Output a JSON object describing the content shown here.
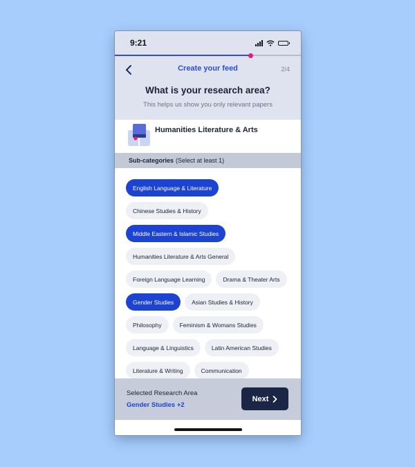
{
  "status_bar": {
    "time": "9:21"
  },
  "progress": {
    "fraction": 0.73
  },
  "nav": {
    "title": "Create your feed",
    "step": "2/4"
  },
  "question": {
    "title": "What is your research area?",
    "subtitle": "This helps us show you only relevant papers"
  },
  "research_area": {
    "name": "Humanities Literature & Arts"
  },
  "subcategories": {
    "heading": "Sub-categories",
    "hint": "(Select at least 1)",
    "chips": [
      {
        "label": "English Language & Literature",
        "selected": true
      },
      {
        "label": "Chinese Studies & History",
        "selected": false
      },
      {
        "label": "Middle Eastern & Islamic Studies",
        "selected": true
      },
      {
        "label": "Humanities Literature & Arts General",
        "selected": false
      },
      {
        "label": "Foreign Language Learning",
        "selected": false
      },
      {
        "label": "Drama & Theater Arts",
        "selected": false
      },
      {
        "label": "Gender Studies",
        "selected": true
      },
      {
        "label": "Asian Studies & History",
        "selected": false
      },
      {
        "label": "Philosophy",
        "selected": false
      },
      {
        "label": "Feminism & Womans Studies",
        "selected": false
      },
      {
        "label": "Language & Linguistics",
        "selected": false
      },
      {
        "label": "Latin American Studies",
        "selected": false
      },
      {
        "label": "Literature & Writing",
        "selected": false
      },
      {
        "label": "Communication",
        "selected": false
      }
    ]
  },
  "footer": {
    "label": "Selected Research Area",
    "value": "Gender Studies +2",
    "next_label": "Next"
  },
  "icons": {
    "back": "chevron-left-icon",
    "next": "chevron-right-icon",
    "area": "book-icon"
  },
  "colors": {
    "accent": "#1d43d2",
    "progress_dot": "#e8187c",
    "next_button": "#1b2646",
    "background": "#a6cdfc"
  }
}
